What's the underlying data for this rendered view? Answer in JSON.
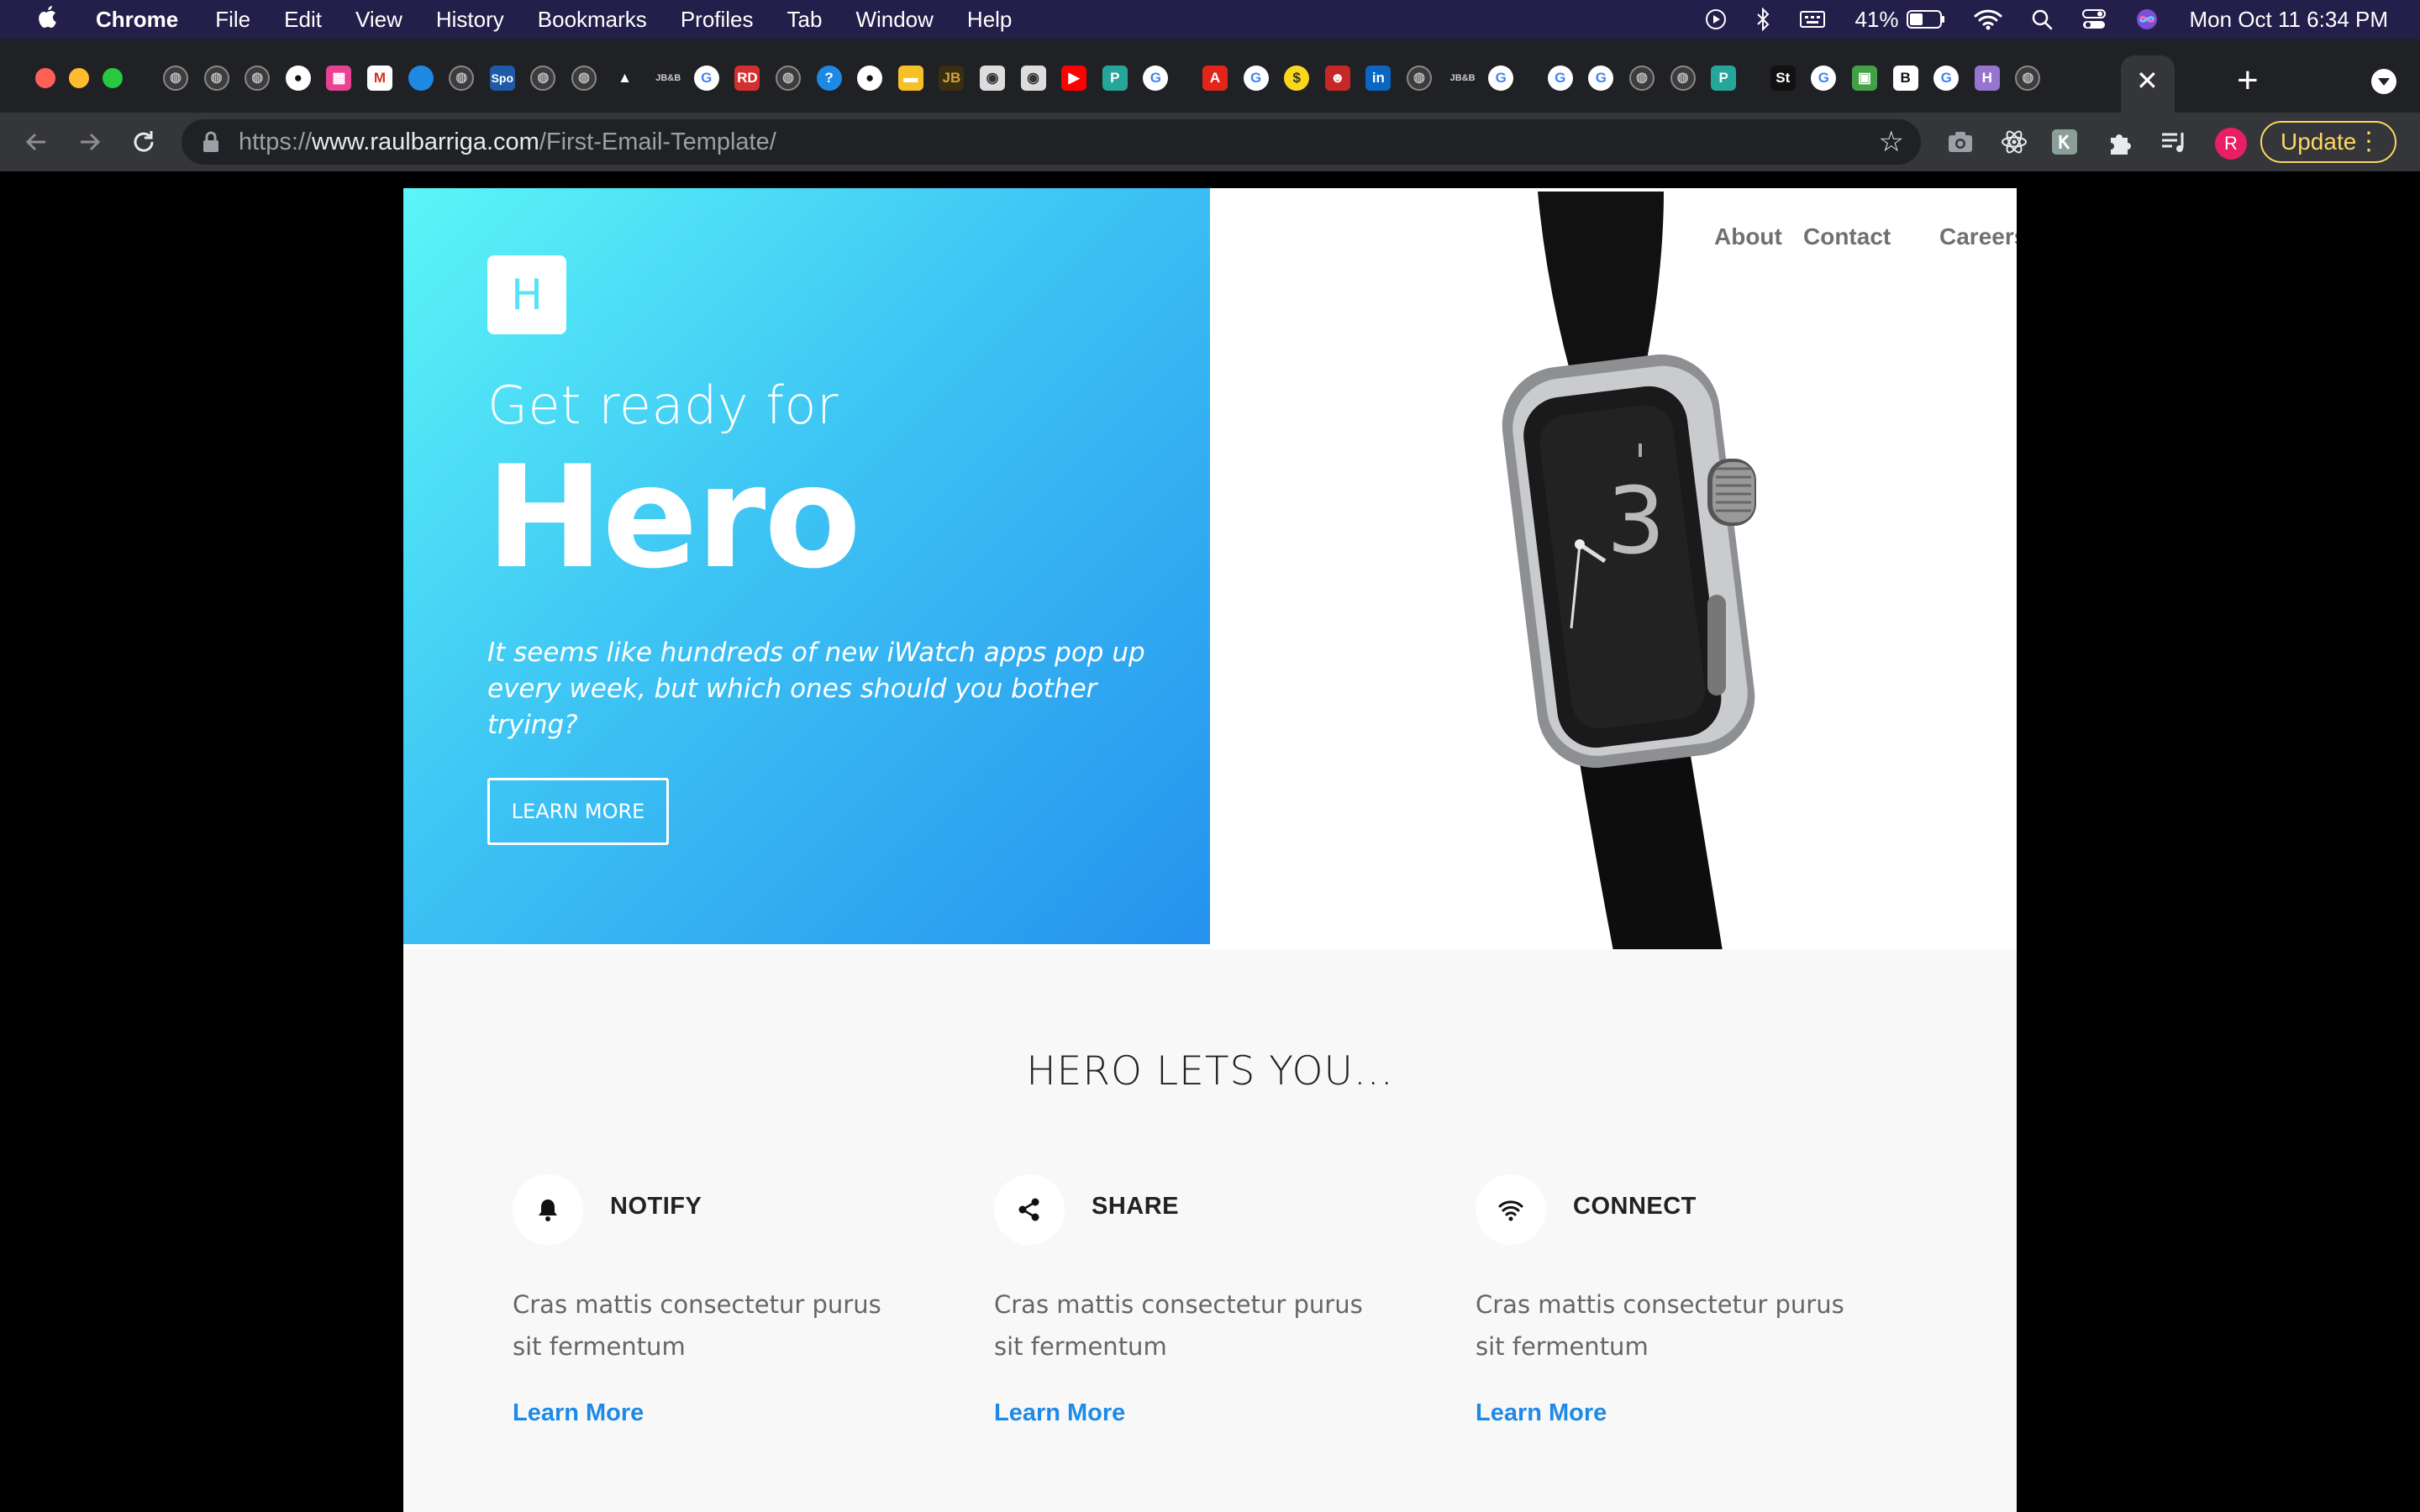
{
  "menubar": {
    "app": "Chrome",
    "menus": [
      "File",
      "Edit",
      "View",
      "History",
      "Bookmarks",
      "Profiles",
      "Tab",
      "Window",
      "Help"
    ],
    "battery": "41%",
    "clock": "Mon Oct 11  6:34 PM"
  },
  "tabs": {
    "favicons": [
      "globe",
      "globe",
      "globe",
      "github",
      "pink-square",
      "gmail",
      "blue-circle",
      "globe",
      "spo",
      "globe",
      "globe",
      "drive",
      "jbb",
      "google",
      "rd",
      "globe",
      "help",
      "github",
      "yellow",
      "jbb-gold",
      "owl",
      "owl",
      "youtube",
      "teal-p",
      "google",
      "adobe",
      "google",
      "yellow-s",
      "face",
      "linkedin",
      "globe",
      "jbb",
      "google",
      "google",
      "google",
      "globe",
      "globe",
      "teal-p",
      "st",
      "google",
      "green",
      "b",
      "google",
      "purple-h",
      "globe"
    ],
    "favicon_labels": {
      "spo": "Spo",
      "rd": "RD",
      "jbb": "JB&B",
      "st": "St",
      "b": "B",
      "help": "?",
      "yellow-s": "$",
      "teal-p": "P",
      "purple-h": "H",
      "linkedin": "in"
    },
    "active_close": "✕",
    "new_tab": "+"
  },
  "toolbar": {
    "url_scheme": "https://",
    "url_host": "www.raulbarriga.com",
    "url_path": "/First-Email-Template/",
    "profile_initial": "R",
    "update_label": "Update"
  },
  "hero": {
    "logo_letter": "H",
    "pretitle": "Get ready for",
    "title": "Hero",
    "description": "It seems like hundreds of new iWatch apps pop up every week, but which ones should you bother trying?",
    "button": "LEARN MORE",
    "gradient_start": "#5bf6f7",
    "gradient_end": "#2592ee"
  },
  "nav": {
    "about": "About",
    "careers": "Careers",
    "contact": "Contact"
  },
  "features": {
    "heading": "HERO LETS YOU...",
    "items": [
      {
        "icon": "bell-icon",
        "title": "NOTIFY",
        "text": "Cras mattis consectetur purus sit fermentum",
        "link": "Learn More"
      },
      {
        "icon": "share-icon",
        "title": "SHARE",
        "text": "Cras mattis consectetur purus sit fermentum",
        "link": "Learn More"
      },
      {
        "icon": "wifi-icon",
        "title": "CONNECT",
        "text": "Cras mattis consectetur purus sit fermentum",
        "link": "Learn More"
      }
    ],
    "link_color": "#1e8ae8"
  }
}
